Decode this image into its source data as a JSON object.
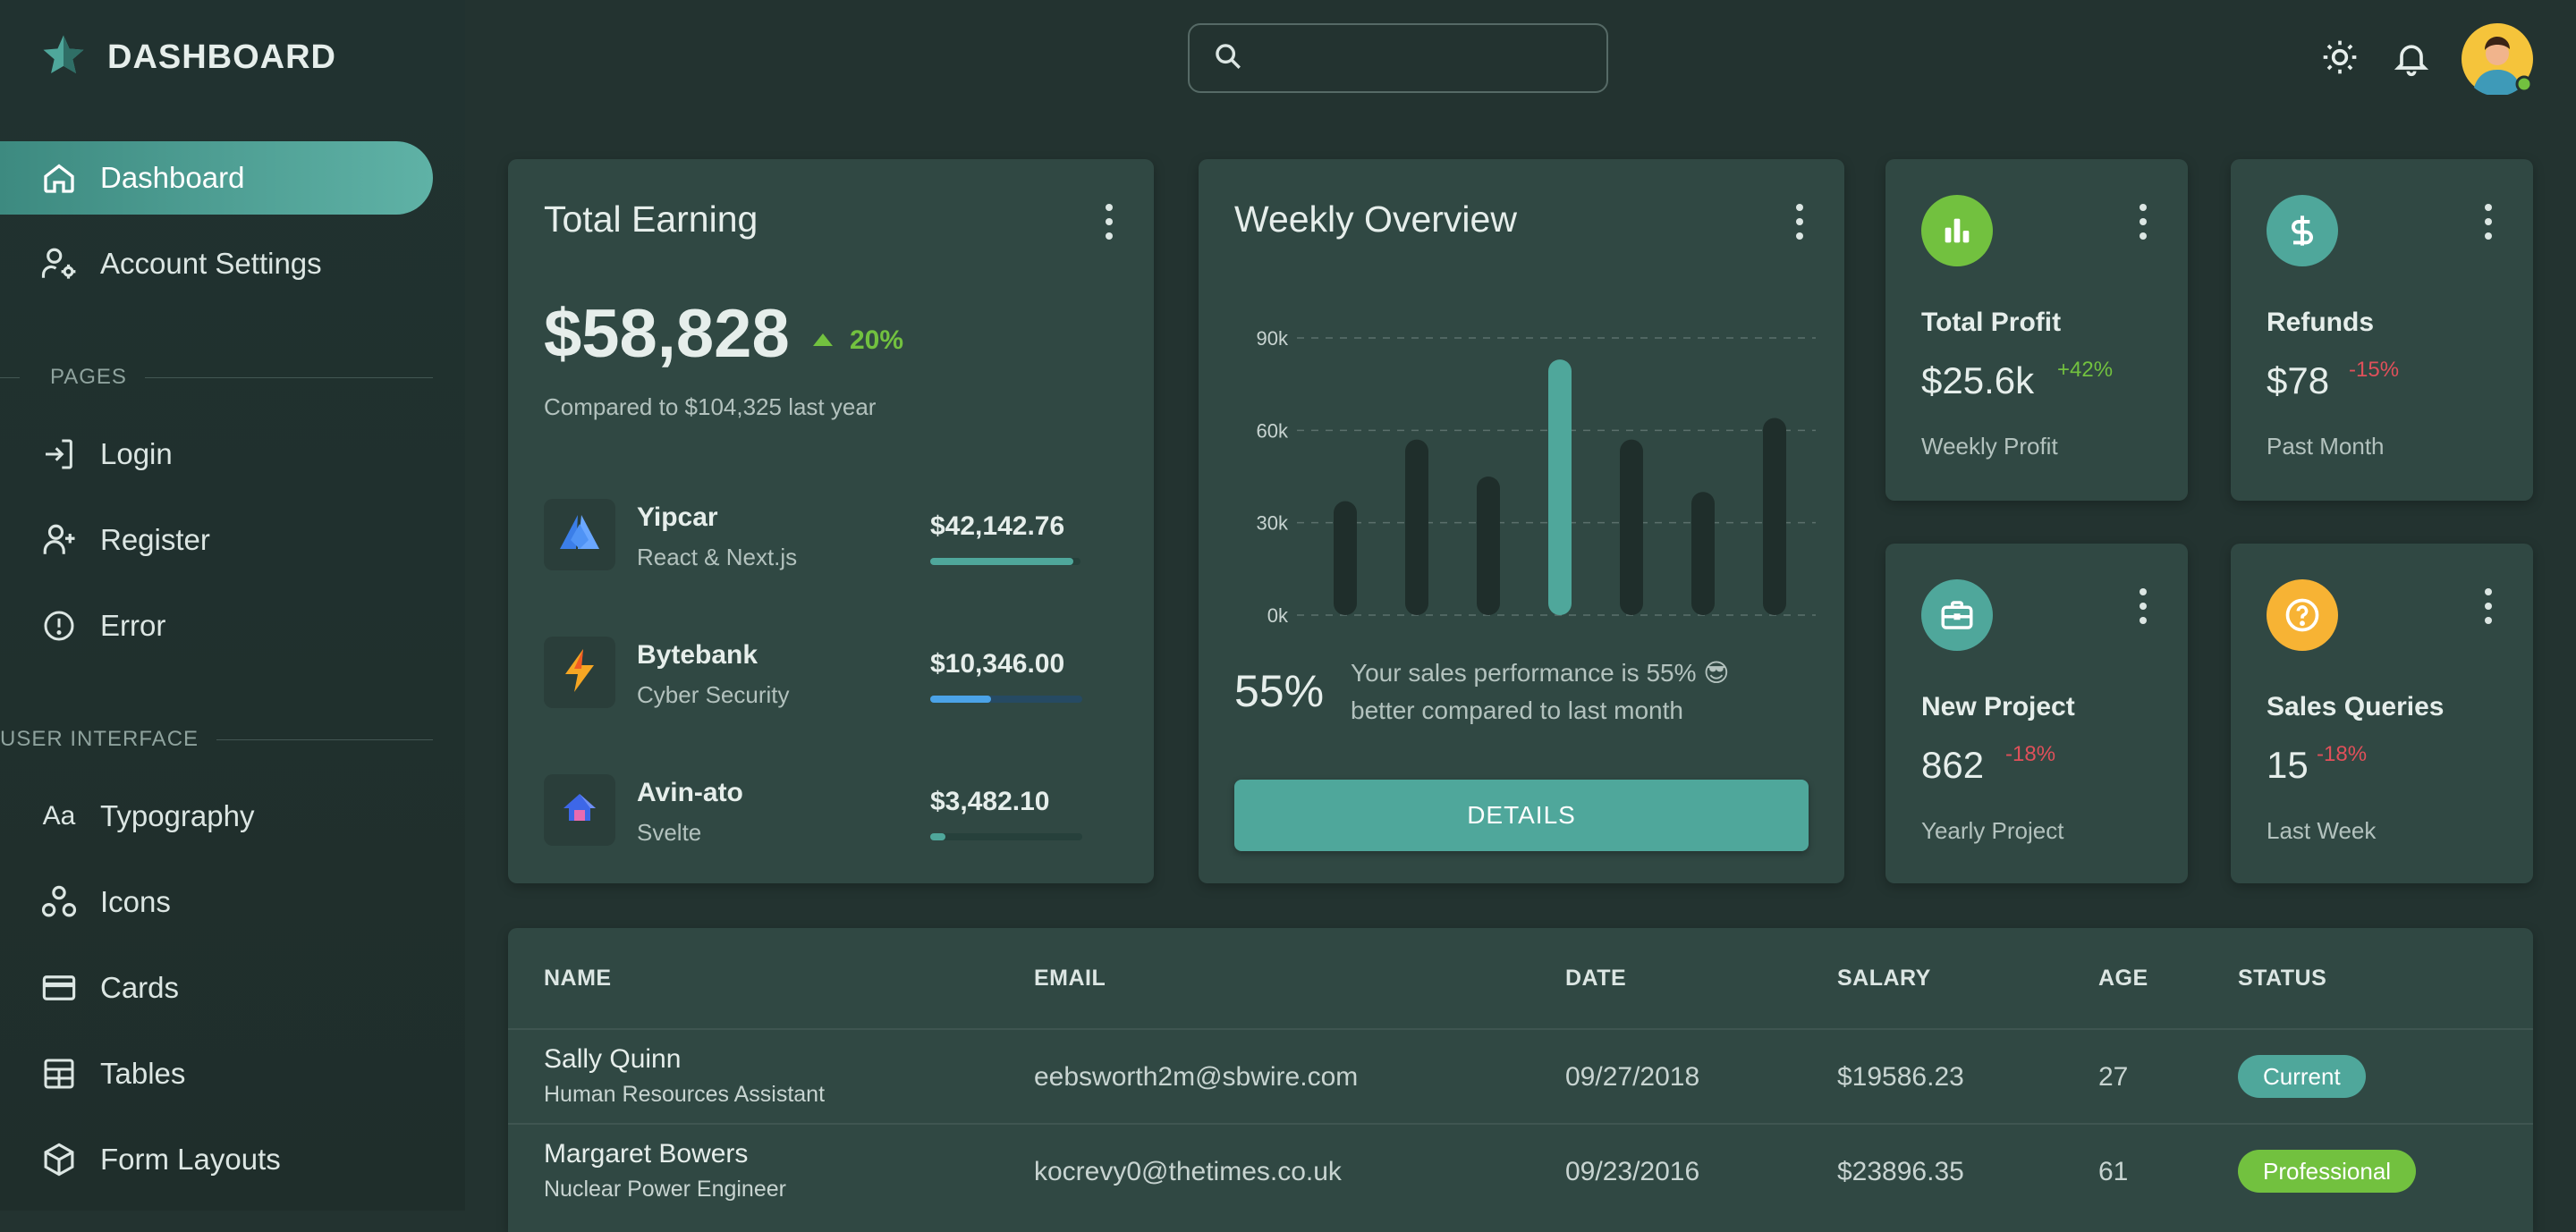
{
  "brand": {
    "title": "DASHBOARD"
  },
  "nav": {
    "dashboard": "Dashboard",
    "account_settings": "Account Settings",
    "pages_section": "PAGES",
    "login": "Login",
    "register": "Register",
    "error": "Error",
    "ui_section": "USER INTERFACE",
    "typography": "Typography",
    "typography_glyph": "Aa",
    "icons": "Icons",
    "cards": "Cards",
    "tables": "Tables",
    "form_layouts": "Form Layouts"
  },
  "search": {
    "placeholder": ""
  },
  "earning": {
    "title": "Total Earning",
    "amount": "$58,828",
    "change": "20%",
    "compare": "Compared to $104,325 last year",
    "items": [
      {
        "name": "Yipcar",
        "sub": "React & Next.js",
        "amount": "$42,142.76",
        "progress": 0.95,
        "color": "#4fa79b"
      },
      {
        "name": "Bytebank",
        "sub": "Cyber Security",
        "amount": "$10,346.00",
        "progress": 0.4,
        "color": "#4ba3e8"
      },
      {
        "name": "Avin-ato",
        "sub": "Svelte",
        "amount": "$3,482.10",
        "progress": 0.1,
        "color": "#4fa79b"
      }
    ]
  },
  "weekly": {
    "title": "Weekly Overview",
    "percent": "55%",
    "message": "Your sales performance is 55% 😎 better compared to last month",
    "button": "DETAILS"
  },
  "chart_data": {
    "type": "bar",
    "categories": [
      "",
      "",
      "",
      "",
      "",
      "",
      ""
    ],
    "values": [
      37,
      57,
      45,
      83,
      57,
      40,
      64
    ],
    "highlight_index": 3,
    "ylim": [
      0,
      90
    ],
    "yticks": [
      "0k",
      "30k",
      "60k",
      "90k"
    ],
    "ytick_values": [
      0,
      30,
      60,
      90
    ],
    "grid": true,
    "bar_color": "#1f2e2b",
    "highlight_color": "#4fa79b"
  },
  "stats": [
    {
      "title": "Total Profit",
      "value": "$25.6k",
      "change": "+42%",
      "change_color": "#72c13f",
      "sub": "Weekly Profit",
      "icon_color": "#72c13f",
      "icon": "bar-chart-icon"
    },
    {
      "title": "Refunds",
      "value": "$78",
      "change": "-15%",
      "change_color": "#e0505a",
      "sub": "Past Month",
      "icon_color": "#4fa79b",
      "icon": "dollar-icon"
    },
    {
      "title": "New Project",
      "value": "862",
      "change": "-18%",
      "change_color": "#e0505a",
      "sub": "Yearly Project",
      "icon_color": "#4fa79b",
      "icon": "briefcase-icon"
    },
    {
      "title": "Sales Queries",
      "value": "15",
      "change": "-18%",
      "change_color": "#e0505a",
      "sub": "Last Week",
      "icon_color": "#f7b334",
      "icon": "help-icon"
    }
  ],
  "table": {
    "headers": [
      "NAME",
      "EMAIL",
      "DATE",
      "SALARY",
      "AGE",
      "STATUS"
    ],
    "rows": [
      {
        "name": "Sally Quinn",
        "role": "Human Resources Assistant",
        "email": "eebsworth2m@sbwire.com",
        "date": "09/27/2018",
        "salary": "$19586.23",
        "age": "27",
        "status": "Current",
        "status_color": "#4fa79b"
      },
      {
        "name": "Margaret Bowers",
        "role": "Nuclear Power Engineer",
        "email": "kocrevy0@thetimes.co.uk",
        "date": "09/23/2016",
        "salary": "$23896.35",
        "age": "61",
        "status": "Professional",
        "status_color": "#72c13f"
      }
    ]
  },
  "colors": {
    "accent": "#4fa79b",
    "success": "#72c13f",
    "error": "#e0505a",
    "warning": "#f7b334",
    "background": "#233330",
    "card": "#304843"
  }
}
